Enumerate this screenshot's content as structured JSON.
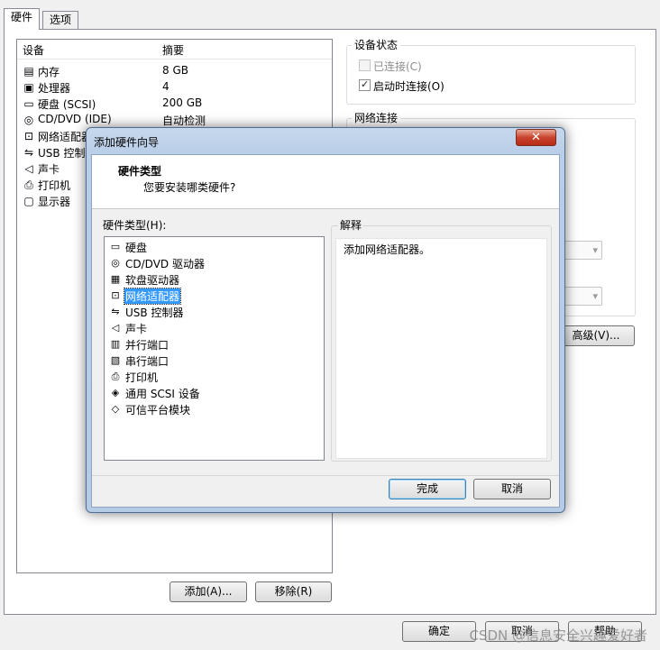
{
  "tabs": [
    {
      "label": "硬件"
    },
    {
      "label": "选项"
    }
  ],
  "device_list": {
    "columns": [
      "设备",
      "摘要"
    ],
    "rows": [
      {
        "icon": "memory-icon",
        "name": "内存",
        "summary": "8 GB"
      },
      {
        "icon": "processor-icon",
        "name": "处理器",
        "summary": "4"
      },
      {
        "icon": "hard-disk-icon",
        "name": "硬盘 (SCSI)",
        "summary": "200 GB"
      },
      {
        "icon": "cd-dvd-icon",
        "name": "CD/DVD (IDE)",
        "summary": "自动检测"
      },
      {
        "icon": "network-adapter-icon",
        "name": "网络适配器",
        "summary": ""
      },
      {
        "icon": "usb-icon",
        "name": "USB 控制器",
        "summary": ""
      },
      {
        "icon": "sound-card-icon",
        "name": "声卡",
        "summary": ""
      },
      {
        "icon": "printer-icon",
        "name": "打印机",
        "summary": ""
      },
      {
        "icon": "monitor-icon",
        "name": "显示器",
        "summary": ""
      }
    ]
  },
  "buttons": {
    "add": "添加(A)...",
    "remove": "移除(R)",
    "advanced": "高级(V)...",
    "ok": "确定",
    "cancel": "取消",
    "help": "帮助"
  },
  "device_status": {
    "title": "设备状态",
    "connected": {
      "label": "已连接(C)",
      "checked": false,
      "enabled": false
    },
    "connect_at_power_on": {
      "label": "启动时连接(O)",
      "checked": true,
      "enabled": true
    }
  },
  "network_connection": {
    "title": "网络连接"
  },
  "wizard": {
    "title": "添加硬件向导",
    "close_glyph": "✕",
    "header_title": "硬件类型",
    "header_subtitle": "您要安装哪类硬件?",
    "list_label": "硬件类型(H):",
    "items": [
      {
        "icon": "hard-disk-icon",
        "label": "硬盘",
        "selected": false
      },
      {
        "icon": "cd-dvd-icon",
        "label": "CD/DVD 驱动器",
        "selected": false
      },
      {
        "icon": "floppy-icon",
        "label": "软盘驱动器",
        "selected": false
      },
      {
        "icon": "network-adapter-icon",
        "label": "网络适配器",
        "selected": true
      },
      {
        "icon": "usb-icon",
        "label": "USB 控制器",
        "selected": false
      },
      {
        "icon": "sound-card-icon",
        "label": "声卡",
        "selected": false
      },
      {
        "icon": "parallel-port-icon",
        "label": "并行端口",
        "selected": false
      },
      {
        "icon": "serial-port-icon",
        "label": "串行端口",
        "selected": false
      },
      {
        "icon": "printer-icon",
        "label": "打印机",
        "selected": false
      },
      {
        "icon": "scsi-device-icon",
        "label": "通用 SCSI 设备",
        "selected": false
      },
      {
        "icon": "tpm-icon",
        "label": "可信平台模块",
        "selected": false
      }
    ],
    "explain_title": "解释",
    "explain_text": "添加网络适配器。",
    "finish": "完成",
    "cancel": "取消"
  },
  "watermark": "CSDN @信息安全兴趣爱好者"
}
